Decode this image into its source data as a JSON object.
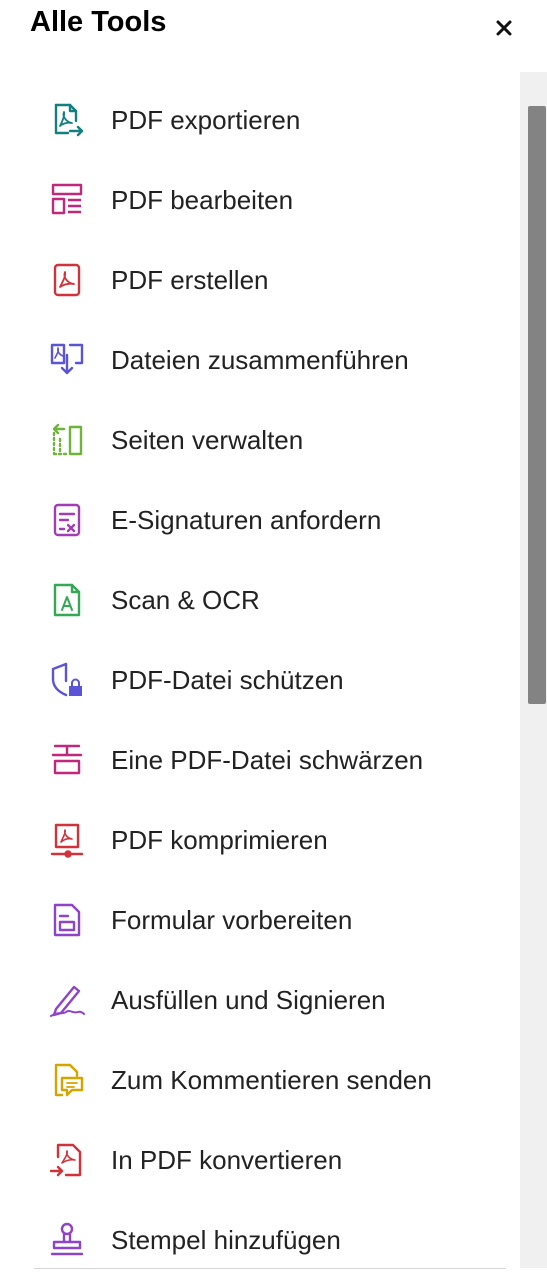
{
  "panel": {
    "title": "Alle Tools",
    "close_symbol": "×"
  },
  "tools": [
    {
      "label": "PDF exportieren",
      "icon": "export-pdf-icon",
      "color": "#12807e"
    },
    {
      "label": "PDF bearbeiten",
      "icon": "edit-pdf-icon",
      "color": "#c1287b"
    },
    {
      "label": "PDF erstellen",
      "icon": "create-pdf-icon",
      "color": "#d2323a"
    },
    {
      "label": "Dateien zusammenführen",
      "icon": "combine-files-icon",
      "color": "#5a55d6"
    },
    {
      "label": "Seiten verwalten",
      "icon": "organize-pages-icon",
      "color": "#6fb43a"
    },
    {
      "label": "E-Signaturen anfordern",
      "icon": "request-esign-icon",
      "color": "#a13cb5"
    },
    {
      "label": "Scan & OCR",
      "icon": "scan-ocr-icon",
      "color": "#34a853"
    },
    {
      "label": "PDF-Datei schützen",
      "icon": "protect-pdf-icon",
      "color": "#5a55d6"
    },
    {
      "label": "Eine PDF-Datei schwärzen",
      "icon": "redact-pdf-icon",
      "color": "#c1287b"
    },
    {
      "label": "PDF komprimieren",
      "icon": "compress-pdf-icon",
      "color": "#d2323a"
    },
    {
      "label": "Formular vorbereiten",
      "icon": "prepare-form-icon",
      "color": "#8e44c8"
    },
    {
      "label": "Ausfüllen und Signieren",
      "icon": "fill-sign-icon",
      "color": "#8e44c8"
    },
    {
      "label": "Zum Kommentieren senden",
      "icon": "send-comments-icon",
      "color": "#d4a400"
    },
    {
      "label": "In PDF konvertieren",
      "icon": "convert-to-pdf-icon",
      "color": "#d2323a"
    },
    {
      "label": "Stempel hinzufügen",
      "icon": "add-stamp-icon",
      "color": "#8e44c8"
    }
  ]
}
